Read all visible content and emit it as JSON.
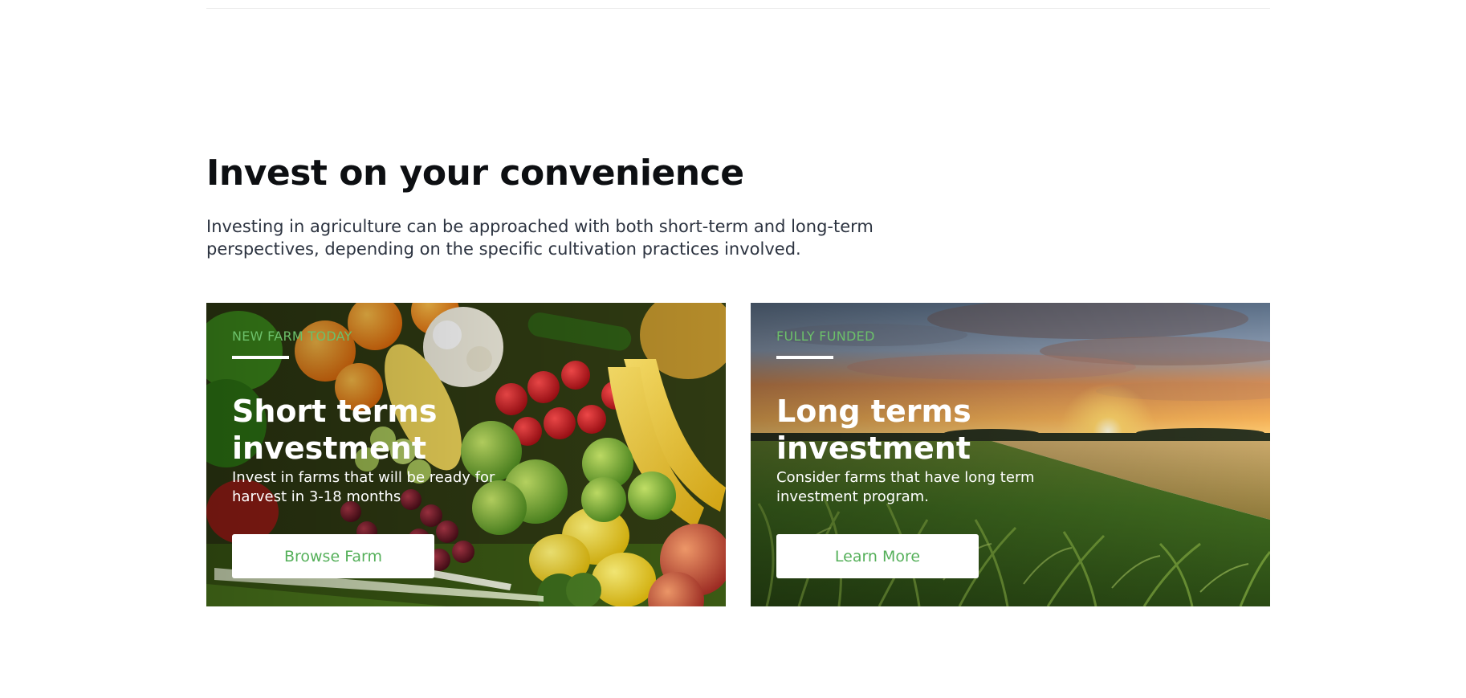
{
  "section": {
    "title": "Invest on your convenience",
    "description": "Investing in agriculture can be approached with both short-term and long-term perspectives, depending on the specific cultivation practices involved."
  },
  "cards": [
    {
      "tag": "NEW FARM TODAY",
      "title": "Short terms investment",
      "text": "Invest in farms that will be ready for harvest in 3-18 months",
      "button": "Browse Farm",
      "image": "fruits-and-vegetables"
    },
    {
      "tag": "FULLY FUNDED",
      "title": "Long terms investment",
      "text": "Consider farms that have long term investment program.",
      "button": "Learn More",
      "image": "cornfield-at-sunset"
    }
  ],
  "colors": {
    "accent_green": "#55b05a",
    "tag_green": "#6cc06a",
    "heading": "#0d0f12",
    "body_text": "#2c3340"
  }
}
